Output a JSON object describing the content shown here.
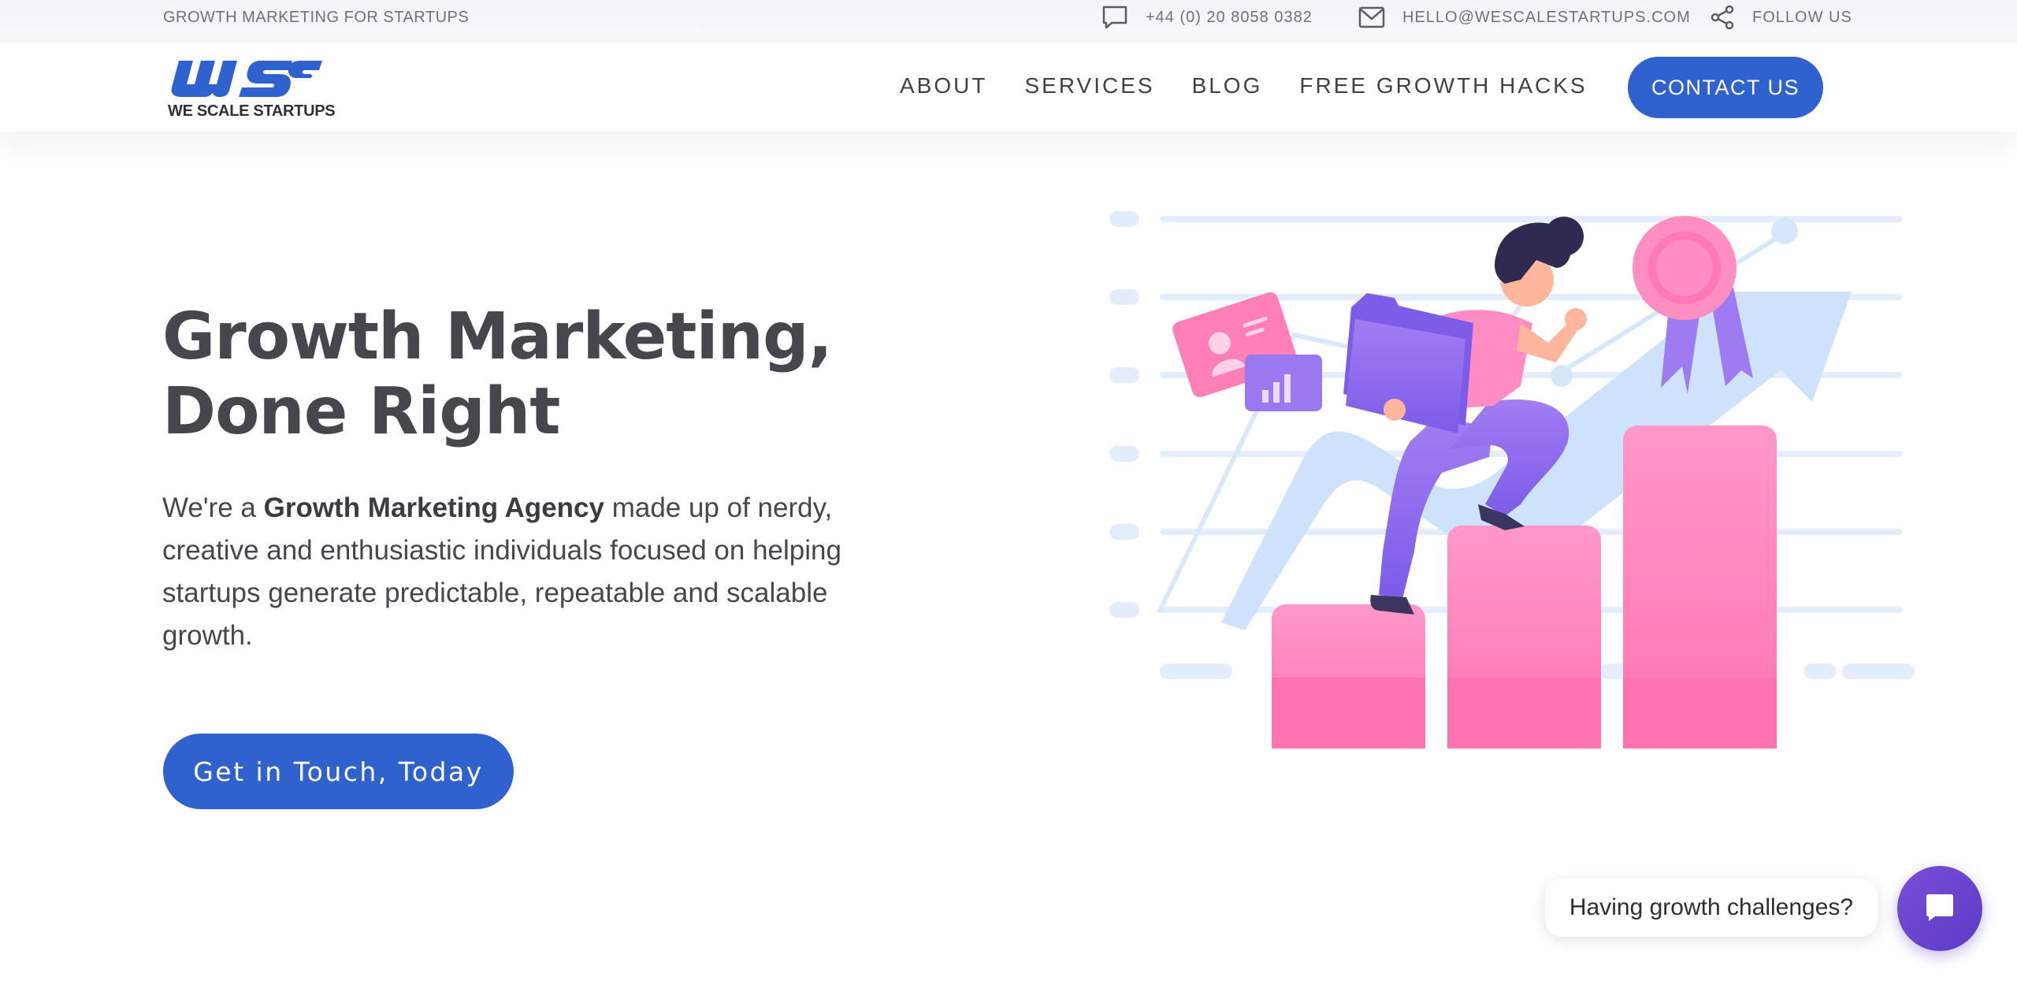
{
  "topbar": {
    "tagline": "GROWTH MARKETING FOR STARTUPS",
    "phone": "+44 (0) 20 8058 0382",
    "email": "HELLO@WESCALESTARTUPS.COM",
    "follow": "FOLLOW US"
  },
  "nav": {
    "logo_text": "WE SCALE STARTUPS",
    "items": [
      "ABOUT",
      "SERVICES",
      "BLOG",
      "FREE GROWTH HACKS"
    ],
    "contact": "CONTACT US"
  },
  "hero": {
    "title_line1": "Growth Marketing,",
    "title_line2": "Done Right",
    "desc_pre": "We're a ",
    "desc_bold": "Growth Marketing Agency",
    "desc_post": " made up of nerdy, creative and enthusiastic individuals focused on helping startups generate predictable, repeatable and scalable growth.",
    "cta": "Get in Touch, Today"
  },
  "chat": {
    "prompt": "Having growth challenges?"
  },
  "colors": {
    "brand_blue": "#3062cf",
    "text_dark": "#45474d",
    "pink": "#ff7fb6",
    "purple": "#8d6ef0",
    "light_blue": "#d6e6fb"
  },
  "icons": [
    "chat-icon",
    "mail-icon",
    "share-icon",
    "chat-bubble-icon"
  ]
}
